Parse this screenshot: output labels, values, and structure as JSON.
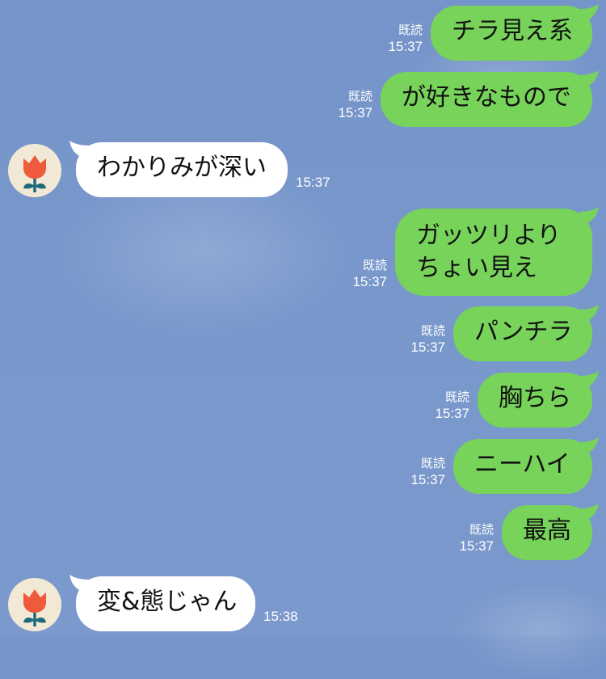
{
  "messages": [
    {
      "side": "out",
      "text": "チラ見え系",
      "read": "既読",
      "time": "15:37"
    },
    {
      "side": "out",
      "text": "が好きなもので",
      "read": "既読",
      "time": "15:37"
    },
    {
      "side": "in",
      "text": "わかりみが深い",
      "time": "15:37"
    },
    {
      "side": "out",
      "text": "ガッツリより\nちょい見え",
      "read": "既読",
      "time": "15:37"
    },
    {
      "side": "out",
      "text": "パンチラ",
      "read": "既読",
      "time": "15:37"
    },
    {
      "side": "out",
      "text": "胸ちら",
      "read": "既読",
      "time": "15:37"
    },
    {
      "side": "out",
      "text": "ニーハイ",
      "read": "既読",
      "time": "15:37"
    },
    {
      "side": "out",
      "text": "最高",
      "read": "既読",
      "time": "15:37"
    },
    {
      "side": "in",
      "text": "変&態じゃん",
      "time": "15:38"
    }
  ],
  "colors": {
    "background": "#7897cb",
    "outgoing_bubble": "#77d35a",
    "incoming_bubble": "#ffffff",
    "meta_text": "#ffffff",
    "avatar_bg": "#f1e9d6",
    "avatar_flower": "#ee5a3c",
    "avatar_stem": "#1f6a7a"
  },
  "icons": {
    "avatar": "red-tulip-flower-icon"
  }
}
